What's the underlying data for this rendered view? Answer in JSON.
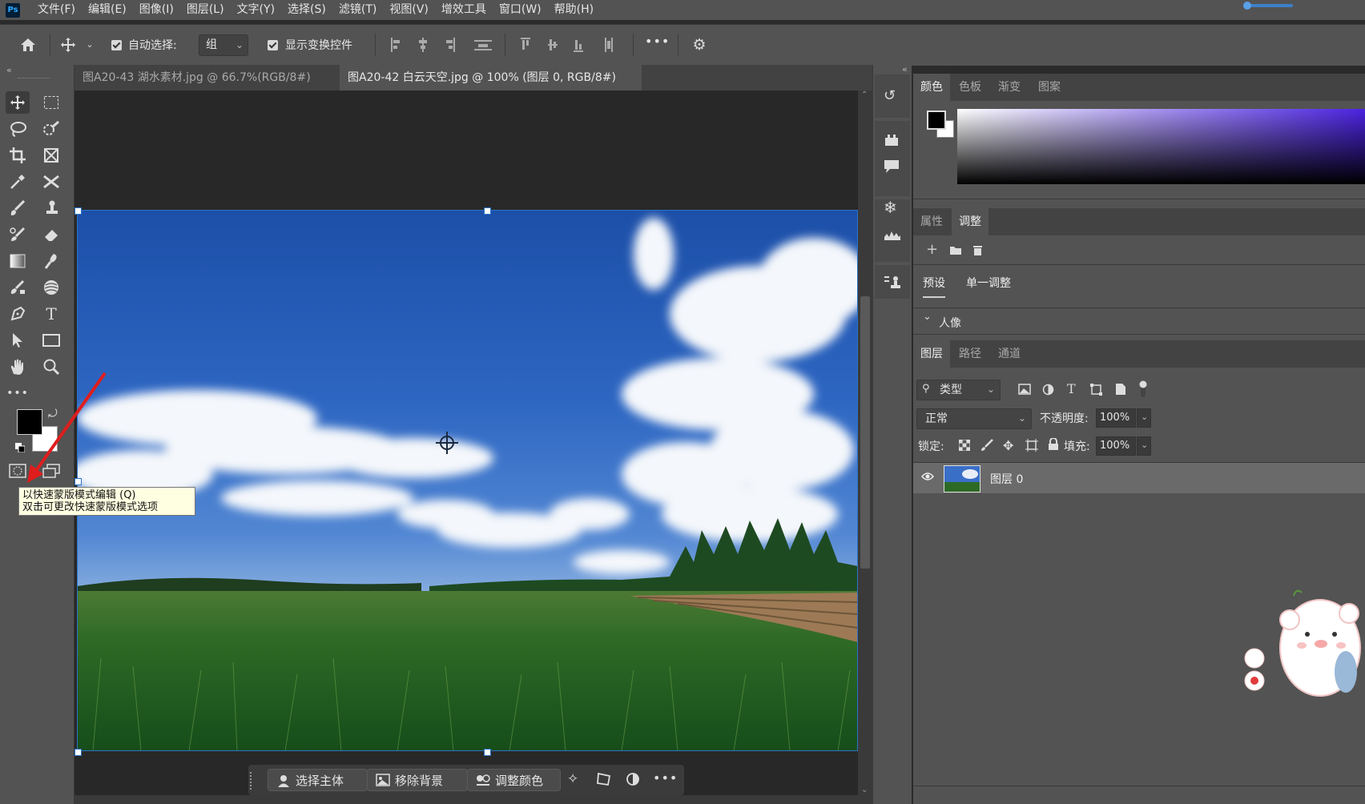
{
  "menubar": {
    "logo": "Ps",
    "items": [
      "文件(F)",
      "编辑(E)",
      "图像(I)",
      "图层(L)",
      "文字(Y)",
      "选择(S)",
      "滤镜(T)",
      "视图(V)",
      "增效工具",
      "窗口(W)",
      "帮助(H)"
    ]
  },
  "options": {
    "auto_select_label": "自动选择:",
    "auto_select_value": "组",
    "show_transform_label": "显示变换控件",
    "more": "•••"
  },
  "tabs": [
    {
      "label": "图A20-43 湖水素材.jpg @ 66.7%(RGB/8#) *",
      "close": "×"
    },
    {
      "label": "图A20-42 白云天空.jpg @ 100% (图层 0, RGB/8#) *",
      "close": "×"
    }
  ],
  "tooltip": {
    "line1": "以快速蒙版模式编辑 (Q)",
    "line2": "双击可更改快速蒙版模式选项"
  },
  "context_bar": {
    "select_subject": "选择主体",
    "remove_bg": "移除背景",
    "adjust_color": "调整颜色",
    "more": "•••"
  },
  "color_panel": {
    "tabs": [
      "颜色",
      "色板",
      "渐变",
      "图案"
    ],
    "foreground": "#000000",
    "background": "#ffffff",
    "spectrum_color": "#4a23e0"
  },
  "adjust_panel": {
    "tabs": [
      "属性",
      "调整"
    ],
    "subtabs": [
      "预设",
      "单一调整"
    ],
    "group": "人像"
  },
  "layers_panel": {
    "tabs": [
      "图层",
      "路径",
      "通道"
    ],
    "filter": "类型",
    "blend_mode": "正常",
    "opacity_label": "不透明度:",
    "opacity_value": "100%",
    "lock_label": "锁定:",
    "fill_label": "填充:",
    "fill_value": "100%",
    "layer_name": "图层 0"
  },
  "colors": {
    "accent": "#2a73c9",
    "ui_dark": "#535353"
  }
}
